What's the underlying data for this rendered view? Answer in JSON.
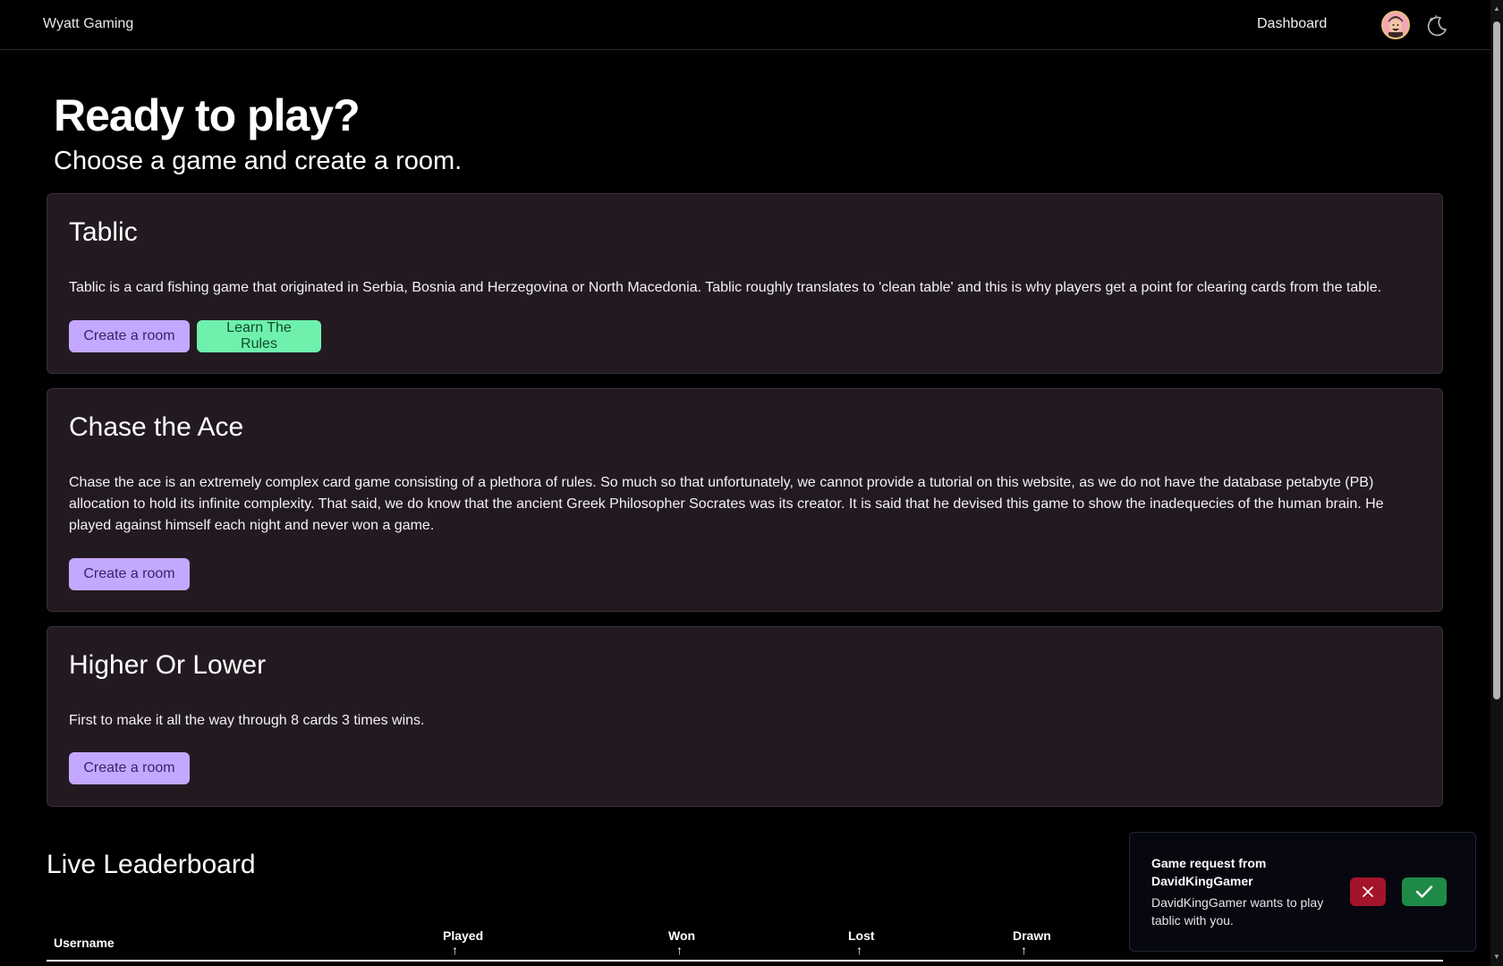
{
  "navbar": {
    "brand": "Wyatt Gaming",
    "dashboard_label": "Dashboard",
    "avatar_icon": "user-avatar",
    "theme_icon": "moon-stars-icon"
  },
  "hero": {
    "title": "Ready to play?",
    "subtitle": "Choose a game and create a room."
  },
  "games": [
    {
      "title": "Tablic",
      "description": "Tablic is a card fishing game that originated in Serbia, Bosnia and Herzegovina or North Macedonia. Tablic roughly translates to 'clean table' and this is why players get a point for clearing cards from the table.",
      "create_label": "Create a room",
      "rules_label": "Learn The Rules"
    },
    {
      "title": "Chase the Ace",
      "description": "Chase the ace is an extremely complex card game consisting of a plethora of rules. So much so that unfortunately, we cannot provide a tutorial on this website, as we do not have the database petabyte (PB) allocation to hold its infinite complexity. That said, we do know that the ancient Greek Philosopher Socrates was its creator. It is said that he devised this game to show the inadequecies of the human brain. He played against himself each night and never won a game.",
      "create_label": "Create a room"
    },
    {
      "title": "Higher Or Lower",
      "description": "First to make it all the way through 8 cards 3 times wins.",
      "create_label": "Create a room"
    }
  ],
  "leaderboard": {
    "title": "Live Leaderboard",
    "columns": {
      "username": "Username",
      "played": "Played",
      "won": "Won",
      "lost": "Lost",
      "drawn": "Drawn"
    },
    "sort_arrow": "↑"
  },
  "toast": {
    "title": "Game request from DavidKingGamer",
    "message": "DavidKingGamer wants to play tablic with you.",
    "decline_icon": "close-icon",
    "accept_icon": "check-icon"
  },
  "colors": {
    "card_bg": "#231a21",
    "purple_button": "#c4a8ff",
    "green_button": "#6ff0ad",
    "decline": "#a3142a",
    "accept": "#1f8a48"
  }
}
